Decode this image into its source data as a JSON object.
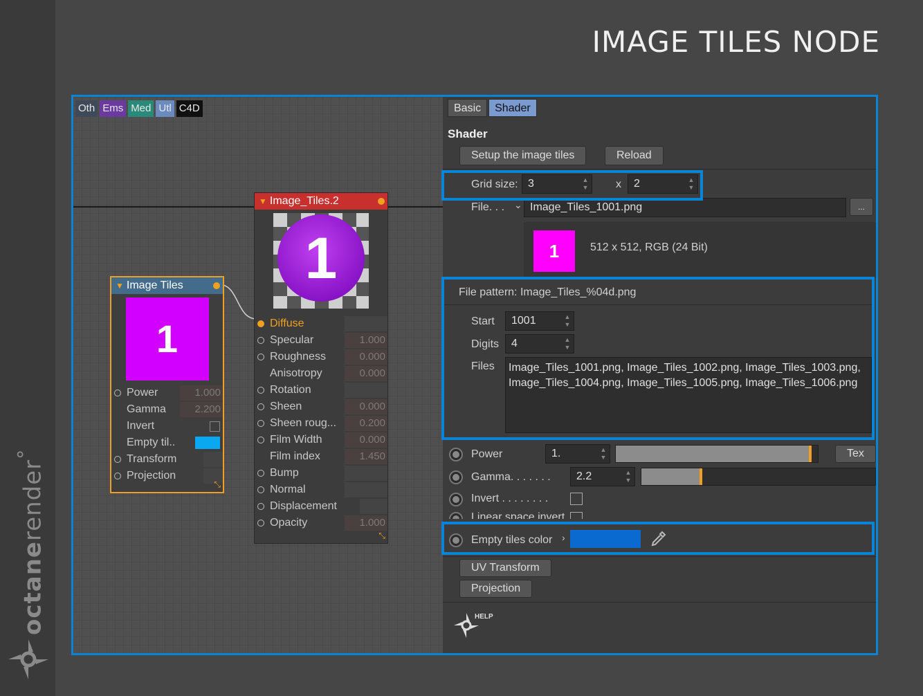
{
  "page_title": "IMAGE TILES NODE",
  "brand": {
    "name_light": "octane",
    "name_rest": "render",
    "mark": "°"
  },
  "tags": [
    {
      "label": "Oth",
      "color": "#3e4a5a"
    },
    {
      "label": "Ems",
      "color": "#6a3aa0"
    },
    {
      "label": "Med",
      "color": "#2a8a7a"
    },
    {
      "label": "Utl",
      "color": "#6a8ac0"
    },
    {
      "label": "C4D",
      "color": "#101010"
    }
  ],
  "node_image_tiles": {
    "title": "Image Tiles",
    "thumbnail_text": "1",
    "ports": [
      {
        "label": "Power",
        "value": "1.000"
      },
      {
        "label": "Gamma",
        "value": "2.200"
      },
      {
        "label": "Invert",
        "value": ""
      },
      {
        "label": "Empty til..",
        "value": ""
      },
      {
        "label": "Transform",
        "value": ""
      },
      {
        "label": "Projection",
        "value": ""
      }
    ]
  },
  "node_material": {
    "title": "Image_Tiles.2",
    "thumbnail_text": "1",
    "ports": [
      {
        "label": "Diffuse",
        "value": ""
      },
      {
        "label": "Specular",
        "value": "1.000"
      },
      {
        "label": "Roughness",
        "value": "0.000"
      },
      {
        "label": "Anisotropy",
        "value": "0.000"
      },
      {
        "label": "Rotation",
        "value": ""
      },
      {
        "label": "Sheen",
        "value": "0.000"
      },
      {
        "label": "Sheen roug...",
        "value": "0.200"
      },
      {
        "label": "Film Width",
        "value": "0.000"
      },
      {
        "label": "Film index",
        "value": "1.450"
      },
      {
        "label": "Bump",
        "value": ""
      },
      {
        "label": "Normal",
        "value": ""
      },
      {
        "label": "Displacement",
        "value": ""
      },
      {
        "label": "Opacity",
        "value": "1.000"
      }
    ]
  },
  "panel": {
    "tabs": [
      "Basic",
      "Shader"
    ],
    "section_title": "Shader",
    "setup_button": "Setup the image tiles",
    "reload_button": "Reload",
    "grid_size_label": "Grid size:",
    "grid_x": "3",
    "grid_x_sep": "x",
    "grid_y": "2",
    "file_label": "File. . .",
    "file_value": "Image_Tiles_1001.png",
    "browse_button": "...",
    "preview_text": "1",
    "preview_info": "512 x 512, RGB (24 Bit)",
    "file_pattern_label": "File pattern:",
    "file_pattern_value": "Image_Tiles_%04d.png",
    "start_label": "Start",
    "start_value": "1001",
    "digits_label": "Digits",
    "digits_value": "4",
    "files_label": "Files",
    "files_line1": "Image_Tiles_1001.png, Image_Tiles_1002.png, Image_Tiles_1003.png,",
    "files_line2": "Image_Tiles_1004.png, Image_Tiles_1005.png, Image_Tiles_1006.png",
    "power_label": "Power",
    "power_value": "1.",
    "power_slider_fraction": 0.97,
    "tex_button": "Tex",
    "gamma_label": "Gamma. . . . . . .",
    "gamma_value": "2.2",
    "gamma_slider_fraction": 0.26,
    "invert_label": "Invert . . . . . . . .",
    "linear_label": "Linear space invert",
    "empty_tiles_label": "Empty tiles color",
    "empty_tiles_color": "#0a6ad0",
    "uv_transform_button": "UV Transform",
    "projection_button": "Projection",
    "help_text": "HELP"
  }
}
